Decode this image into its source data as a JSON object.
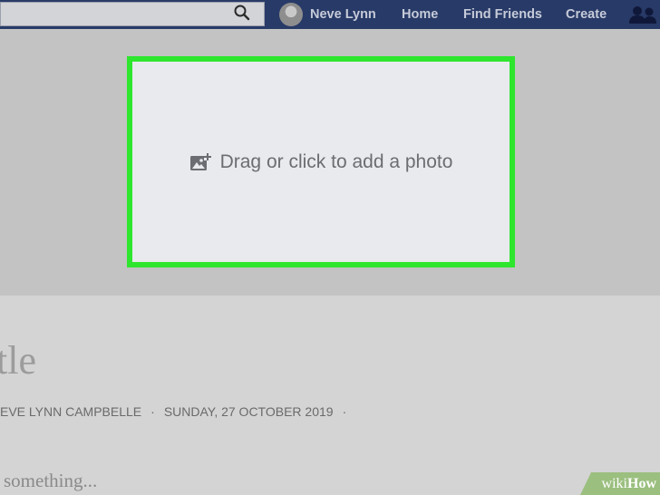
{
  "topbar": {
    "search_value": "",
    "profile_name": "Neve Lynn",
    "nav_links": [
      "Home",
      "Find Friends",
      "Create"
    ]
  },
  "cover": {
    "drop_label": "Drag or click to add a photo",
    "accent_border_color": "#2ee62e"
  },
  "article": {
    "title": "tle",
    "author": "EVE LYNN CAMPBELLE",
    "separator": "·",
    "date": "SUNDAY, 27 OCTOBER 2019",
    "body_placeholder": "something..."
  },
  "watermark": {
    "wiki": "wiki",
    "how": "How"
  }
}
